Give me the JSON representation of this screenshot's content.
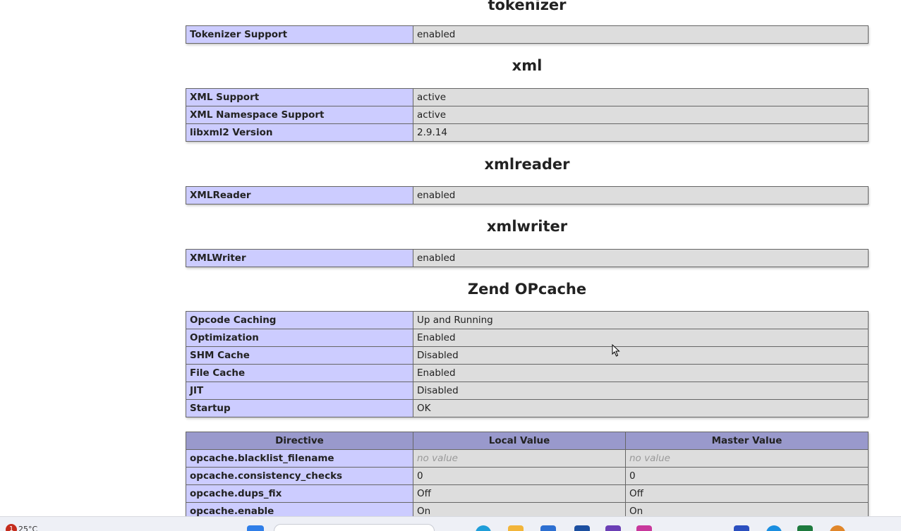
{
  "sections": [
    {
      "title": "tokenizer",
      "rows": [
        {
          "name": "Tokenizer Support",
          "value": "enabled"
        }
      ]
    },
    {
      "title": "xml",
      "rows": [
        {
          "name": "XML Support",
          "value": "active"
        },
        {
          "name": "XML Namespace Support",
          "value": "active"
        },
        {
          "name": "libxml2 Version",
          "value": "2.9.14"
        }
      ]
    },
    {
      "title": "xmlreader",
      "rows": [
        {
          "name": "XMLReader",
          "value": "enabled"
        }
      ]
    },
    {
      "title": "xmlwriter",
      "rows": [
        {
          "name": "XMLWriter",
          "value": "enabled"
        }
      ]
    },
    {
      "title": "Zend OPcache",
      "rows": [
        {
          "name": "Opcode Caching",
          "value": "Up and Running"
        },
        {
          "name": "Optimization",
          "value": "Enabled"
        },
        {
          "name": "SHM Cache",
          "value": "Disabled"
        },
        {
          "name": "File Cache",
          "value": "Enabled"
        },
        {
          "name": "JIT",
          "value": "Disabled"
        },
        {
          "name": "Startup",
          "value": "OK"
        }
      ]
    }
  ],
  "directives": {
    "headers": [
      "Directive",
      "Local Value",
      "Master Value"
    ],
    "rows": [
      {
        "name": "opcache.blacklist_filename",
        "local": "no value",
        "master": "no value"
      },
      {
        "name": "opcache.consistency_checks",
        "local": "0",
        "master": "0"
      },
      {
        "name": "opcache.dups_fix",
        "local": "Off",
        "master": "Off"
      },
      {
        "name": "opcache.enable",
        "local": "On",
        "master": "On"
      }
    ]
  },
  "taskbar": {
    "notification_count": "1",
    "temperature": "25°C",
    "app_icons": [
      "windows-start-icon",
      "edge-icon",
      "file-explorer-icon",
      "store-icon",
      "outlook-icon",
      "vscode-icon",
      "calendar-icon",
      "chrome-icon",
      "excel-icon",
      "app-icon"
    ],
    "icon_colors": [
      "#2f7ee8",
      "#1f9ed9",
      "#f2b53a",
      "#2d6fd1",
      "#1c4fa0",
      "#6b3fb5",
      "#c8389c",
      "#e04d3b",
      "#1e7a3e",
      "#e0862a"
    ]
  }
}
